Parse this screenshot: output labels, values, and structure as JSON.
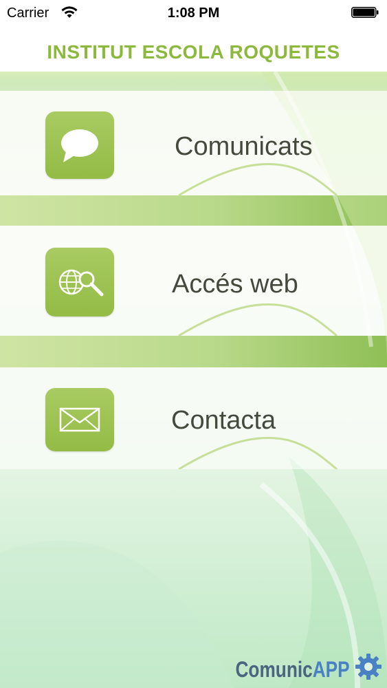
{
  "status_bar": {
    "carrier": "Carrier",
    "time": "1:08 PM"
  },
  "header": {
    "title": "INSTITUT ESCOLA ROQUETES"
  },
  "menu": {
    "items": [
      {
        "label": "Comunicats",
        "icon": "speech-bubble-icon"
      },
      {
        "label": "Accés web",
        "icon": "globe-search-icon"
      },
      {
        "label": "Contacta",
        "icon": "envelope-icon"
      }
    ]
  },
  "footer": {
    "brand_prefix": "Comunic",
    "brand_suffix": "APP",
    "brand_icon": "gear-icon"
  },
  "colors": {
    "accent": "#8cb83c",
    "icon_bg": "#9fc455",
    "label_text": "#434a3c",
    "brand_blue": "#4a80c4"
  }
}
